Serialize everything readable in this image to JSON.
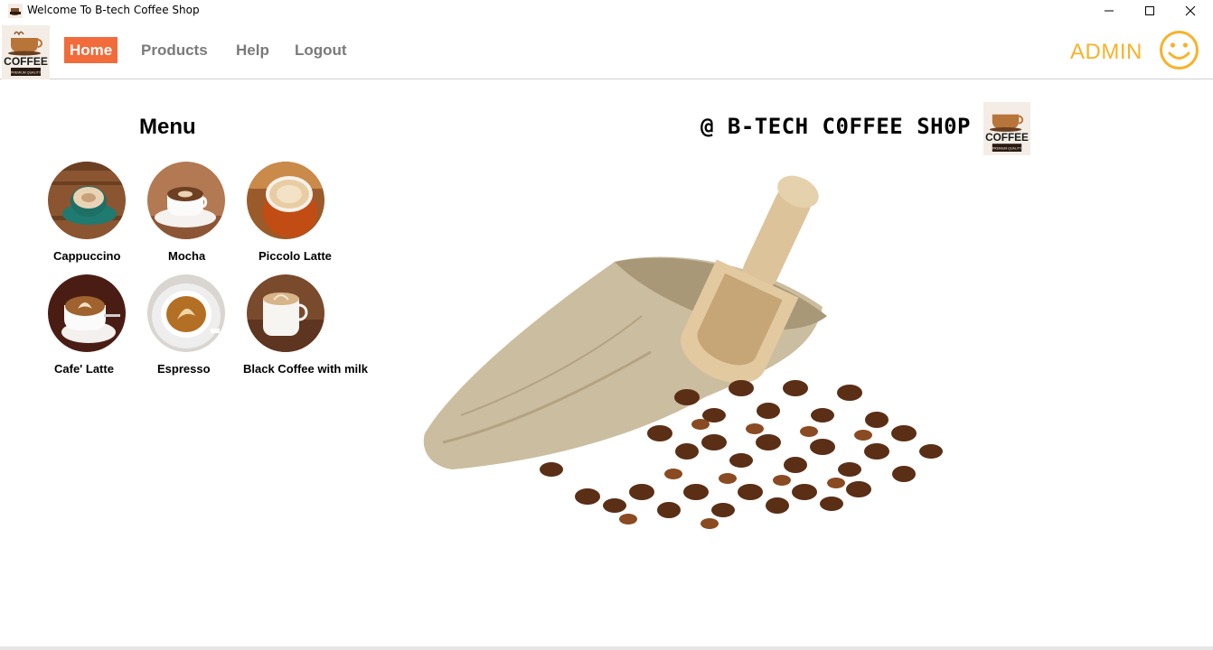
{
  "window": {
    "title": "Welcome To B-tech Coffee Shop",
    "controls": [
      "minimize-icon",
      "maximize-icon",
      "close-icon"
    ]
  },
  "nav": {
    "logo_text": "COFFEE",
    "logo_subtext": "PREMIUM QUALITY",
    "items": [
      {
        "label": "Home",
        "active": true
      },
      {
        "label": "Products",
        "active": false
      },
      {
        "label": "Help",
        "active": false
      },
      {
        "label": "Logout",
        "active": false
      }
    ],
    "user": "ADMIN",
    "user_icon": "smiley-icon"
  },
  "main": {
    "menu_title": "Menu",
    "shop_title": "@ B-TECH C0FFEE SH0P",
    "menu_items": [
      {
        "label": "Cappuccino"
      },
      {
        "label": "Mocha"
      },
      {
        "label": "Piccolo Latte"
      },
      {
        "label": "Cafe' Latte"
      },
      {
        "label": "Espresso"
      },
      {
        "label": "Black Coffee with milk"
      }
    ]
  },
  "colors": {
    "active_nav": "#f26b3a",
    "admin": "#f7b22a",
    "nav_text": "#7a7a7a"
  }
}
